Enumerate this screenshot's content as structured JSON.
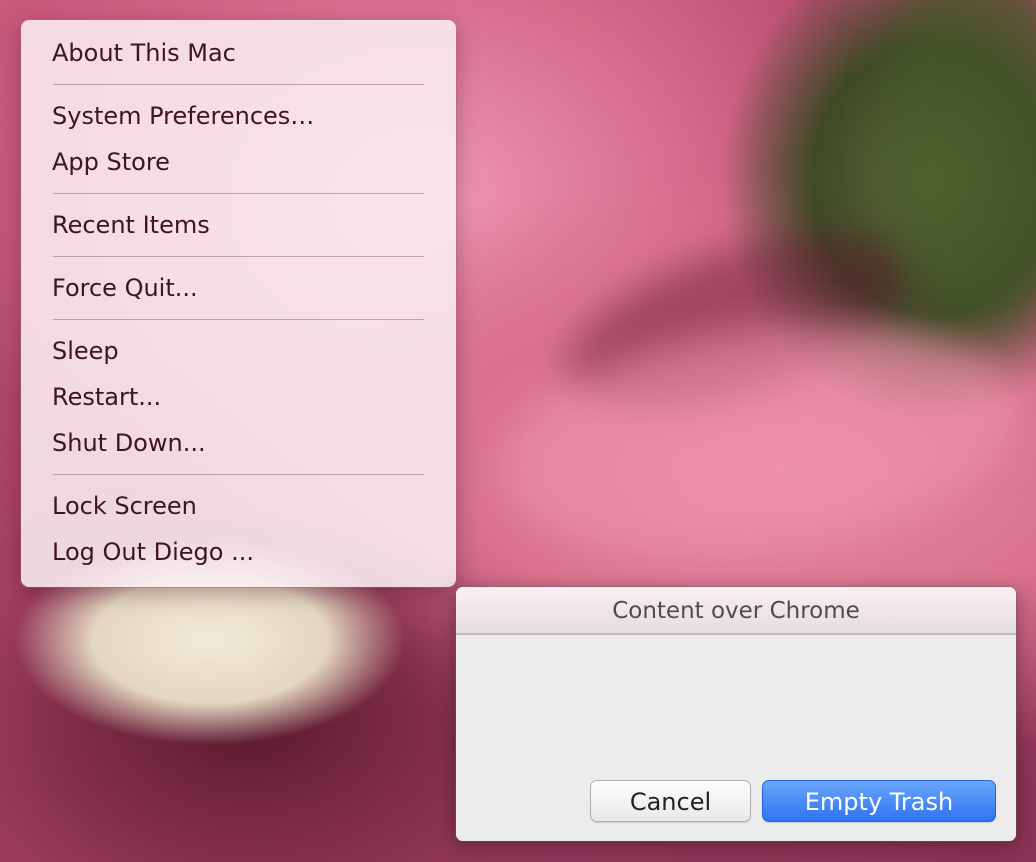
{
  "apple_menu": {
    "groups": [
      [
        "About This Mac"
      ],
      [
        "System Preferences…",
        "App Store"
      ],
      [
        "Recent Items"
      ],
      [
        "Force Quit..."
      ],
      [
        "Sleep",
        "Restart...",
        "Shut Down..."
      ],
      [
        "Lock Screen",
        "Log Out Diego ..."
      ]
    ]
  },
  "dialog": {
    "title": "Content over Chrome",
    "cancel_label": "Cancel",
    "confirm_label": "Empty Trash"
  },
  "colors": {
    "menu_text": "#3e1426",
    "primary_button": "#2f73f0",
    "dialog_background": "#ececec"
  }
}
